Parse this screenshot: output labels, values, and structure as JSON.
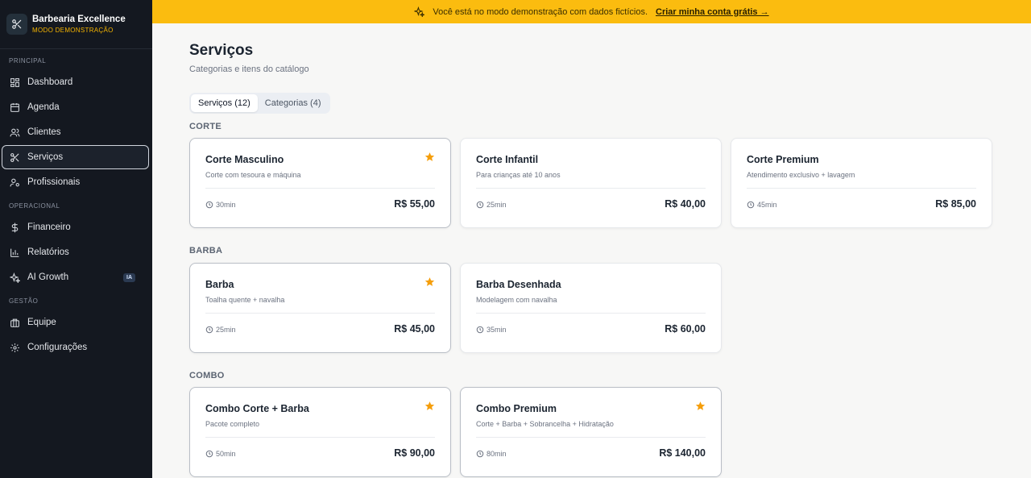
{
  "brand": {
    "name": "Barbearia Excellence",
    "mode": "MODO DEMONSTRAÇÃO",
    "icon": "scissors-icon"
  },
  "sidebar": {
    "sections": [
      {
        "label": "PRINCIPAL",
        "items": [
          {
            "label": "Dashboard",
            "icon": "dashboard-icon"
          },
          {
            "label": "Agenda",
            "icon": "calendar-icon"
          },
          {
            "label": "Clientes",
            "icon": "users-icon"
          },
          {
            "label": "Serviços",
            "icon": "scissors-icon",
            "active": true
          },
          {
            "label": "Profissionais",
            "icon": "user-gear-icon"
          }
        ]
      },
      {
        "label": "OPERACIONAL",
        "items": [
          {
            "label": "Financeiro",
            "icon": "dollar-icon"
          },
          {
            "label": "Relatórios",
            "icon": "bar-chart-icon"
          },
          {
            "label": "AI Growth",
            "icon": "sparkle-icon",
            "badge": "IA"
          }
        ]
      },
      {
        "label": "GESTÃO",
        "items": [
          {
            "label": "Equipe",
            "icon": "briefcase-icon"
          },
          {
            "label": "Configurações",
            "icon": "gear-icon"
          }
        ]
      }
    ]
  },
  "banner": {
    "text": "Você está no modo demonstração com dados fictícios.",
    "cta": "Criar minha conta grátis →",
    "icon": "sparkle-icon"
  },
  "page": {
    "title": "Serviços",
    "subtitle": "Categorias e itens do catálogo"
  },
  "tabs": [
    {
      "label": "Serviços (12)",
      "active": true
    },
    {
      "label": "Categorias (4)",
      "active": false
    }
  ],
  "categories": [
    {
      "label": "CORTE",
      "services": [
        {
          "title": "Corte Masculino",
          "desc": "Corte com tesoura e máquina",
          "duration": "30min",
          "price": "R$ 55,00",
          "starred": true
        },
        {
          "title": "Corte Infantil",
          "desc": "Para crianças até 10 anos",
          "duration": "25min",
          "price": "R$ 40,00",
          "starred": false
        },
        {
          "title": "Corte Premium",
          "desc": "Atendimento exclusivo + lavagem",
          "duration": "45min",
          "price": "R$ 85,00",
          "starred": false
        }
      ]
    },
    {
      "label": "BARBA",
      "services": [
        {
          "title": "Barba",
          "desc": "Toalha quente + navalha",
          "duration": "25min",
          "price": "R$ 45,00",
          "starred": true
        },
        {
          "title": "Barba Desenhada",
          "desc": "Modelagem com navalha",
          "duration": "35min",
          "price": "R$ 60,00",
          "starred": false
        }
      ]
    },
    {
      "label": "COMBO",
      "services": [
        {
          "title": "Combo Corte + Barba",
          "desc": "Pacote completo",
          "duration": "50min",
          "price": "R$ 90,00",
          "starred": true
        },
        {
          "title": "Combo Premium",
          "desc": "Corte + Barba + Sobrancelha + Hidratação",
          "duration": "80min",
          "price": "R$ 140,00",
          "starred": true
        }
      ]
    }
  ],
  "colors": {
    "banner": "#fbbc0f",
    "sidebar": "#141820",
    "star": "#f59e0b",
    "brand_sub": "#f5b400"
  }
}
